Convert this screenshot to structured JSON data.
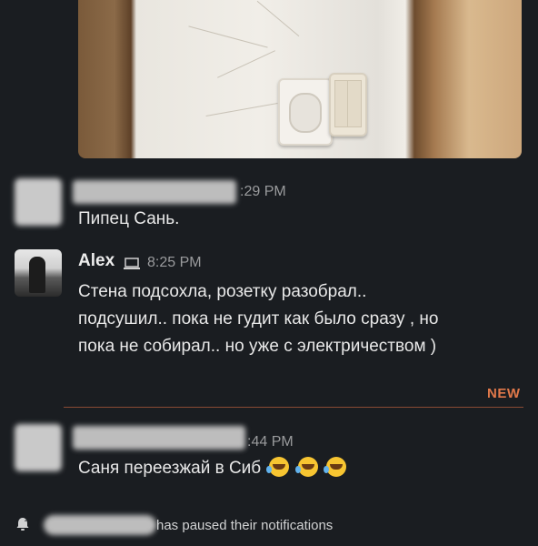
{
  "messages": [
    {
      "time_fragment": ":29 PM",
      "text": "Пипец Сань."
    },
    {
      "author": "Alex",
      "time": "8:25 PM",
      "lines": [
        "Стена подсохла, розетку разобрал..",
        "подсушил.. пока не гудит как было сразу , но",
        "пока не собирал.. но уже с электричеством )"
      ]
    },
    {
      "time_fragment": ":44 PM",
      "text": "Саня переезжай в Сиб",
      "emoji": "rolling-on-floor-laughing"
    }
  ],
  "divider": {
    "label": "NEW"
  },
  "notification": {
    "text": "has paused their notifications"
  },
  "colors": {
    "background": "#1a1d21",
    "new_accent": "#e0784a"
  }
}
